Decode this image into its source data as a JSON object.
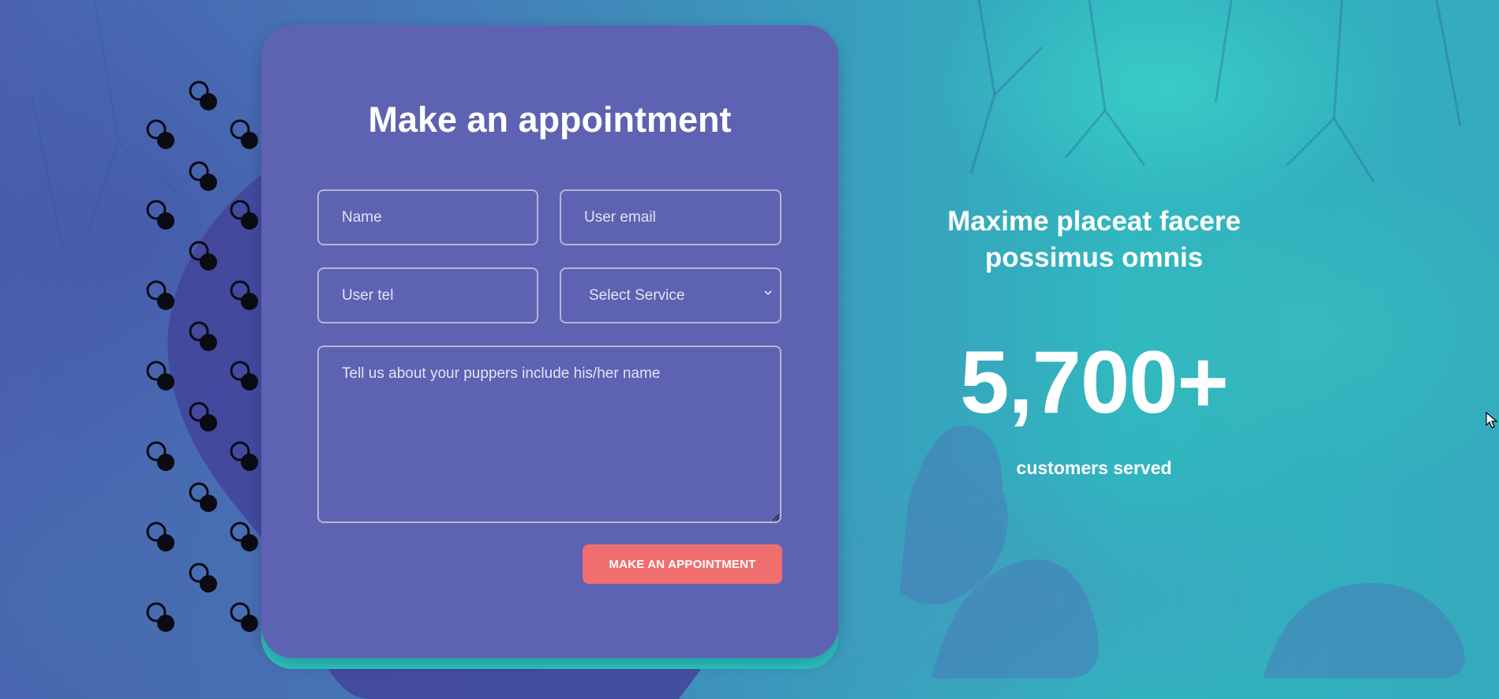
{
  "colors": {
    "card": "#5e62b2",
    "card_accent": "#2bc4bd",
    "button": "#f06f6e",
    "text": "#ffffff",
    "field_border": "#b7b5d6"
  },
  "form": {
    "title": "Make an appointment",
    "name_placeholder": "Name",
    "email_placeholder": "User email",
    "tel_placeholder": "User tel",
    "service_selected": "Select Service",
    "message_placeholder": "Tell us about your puppers include his/her name",
    "submit_label": "Make an appointment"
  },
  "stats": {
    "title": "Maxime placeat facere possimus omnis",
    "number": "5,700+",
    "caption": "customers served"
  },
  "icons": {
    "select_chevron": "chevron-down-icon",
    "resize": "resize-handle-icon",
    "cursor": "mouse-pointer-icon"
  }
}
